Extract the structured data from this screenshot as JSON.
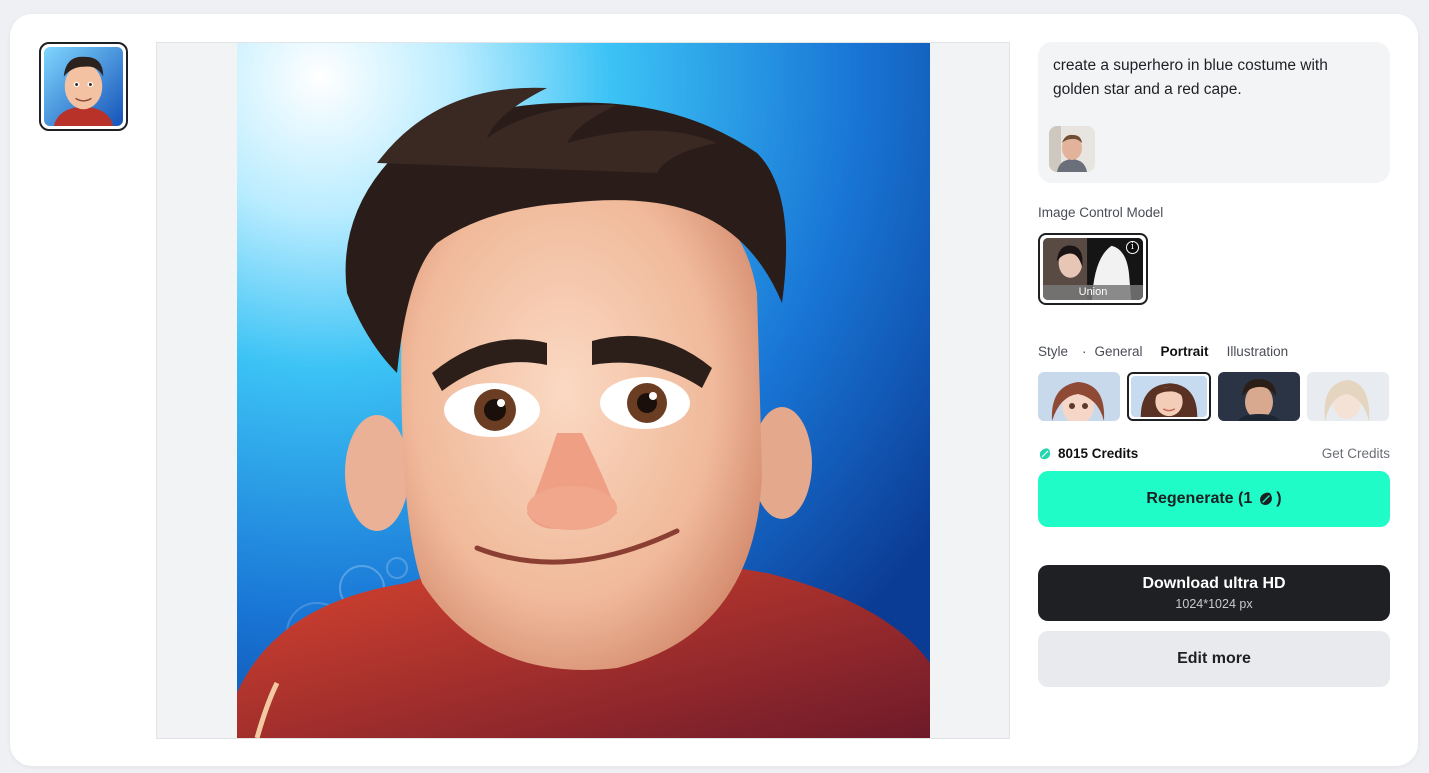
{
  "prompt": {
    "text": "create a superhero in blue costume with golden star and a red cape."
  },
  "image_control": {
    "label": "Image Control Model",
    "model_name": "Union",
    "info_symbol": "i"
  },
  "style": {
    "label": "Style",
    "tabs": [
      "General",
      "Portrait",
      "Illustration"
    ],
    "active_tab": "Portrait",
    "selected_tile_index": 1
  },
  "credits": {
    "amount_label": "8015 Credits",
    "get_label": "Get Credits"
  },
  "buttons": {
    "regenerate_label": "Regenerate (1",
    "regenerate_suffix": ")",
    "download_label": "Download ultra HD",
    "download_sub": "1024*1024 px",
    "edit_label": "Edit more"
  },
  "colors": {
    "accent": "#1ffcc8",
    "dark": "#1f2024"
  },
  "icons": {
    "credit": "gem-icon",
    "info": "info-icon"
  }
}
